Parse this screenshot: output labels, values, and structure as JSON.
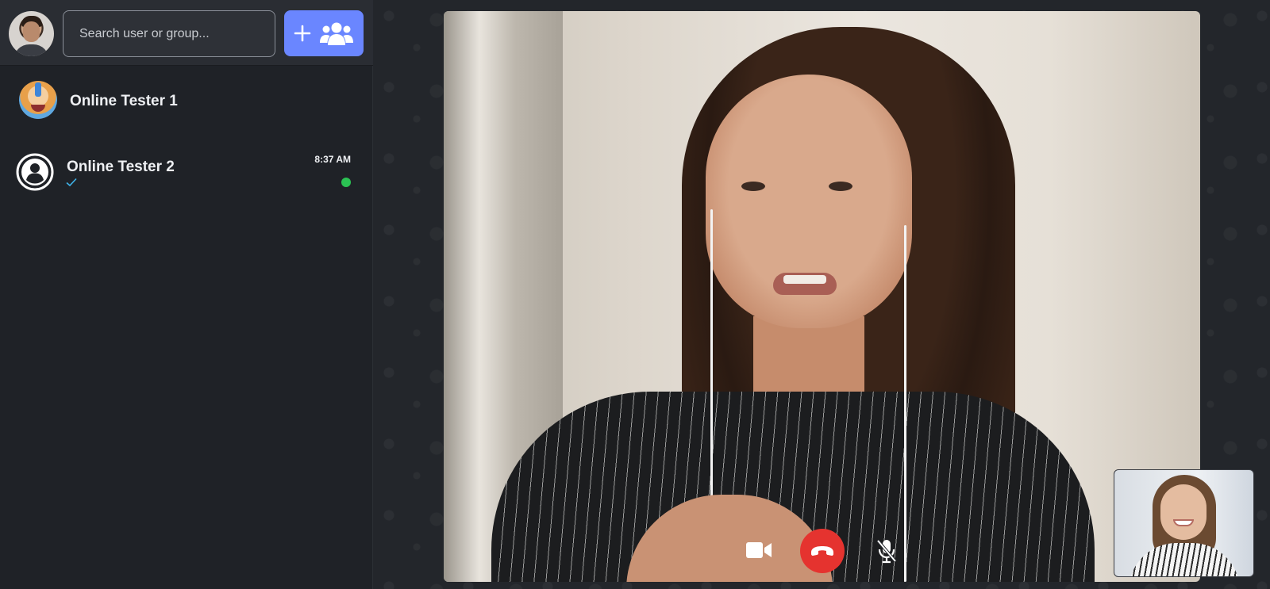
{
  "sidebar": {
    "search": {
      "placeholder": "Search user or group..."
    },
    "chats": [
      {
        "name": "Online Tester 1",
        "time": "",
        "read": false,
        "online": false
      },
      {
        "name": "Online Tester 2",
        "time": "8:37 AM",
        "read": true,
        "online": true
      }
    ]
  },
  "call": {
    "controls": {
      "video_icon": "video-camera-icon",
      "end_icon": "phone-hangup-icon",
      "mute_icon": "microphone-slash-icon"
    }
  },
  "colors": {
    "accent": "#6a86ff",
    "end_call": "#e5332f",
    "online": "#2bc253",
    "read_tick": "#3fb3e8"
  }
}
